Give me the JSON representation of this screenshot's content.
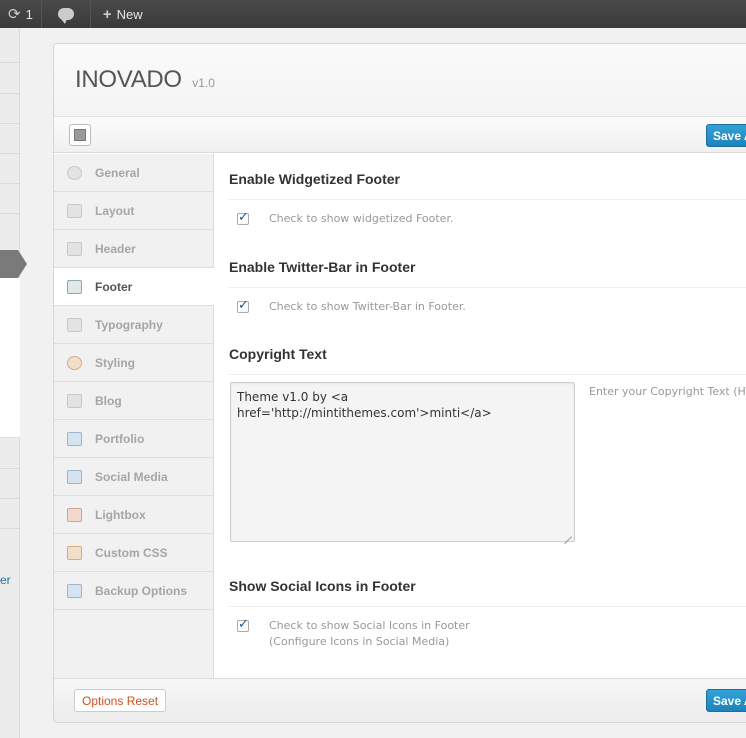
{
  "adminbar": {
    "updates_count": "1",
    "new_label": "New"
  },
  "wp_menu": {
    "partial_link": "er"
  },
  "panel": {
    "theme_name": "INOVADO",
    "theme_version": "v1.0",
    "save_label": "Save Al",
    "reset_label": "Options Reset"
  },
  "nav": [
    {
      "label": "General",
      "icon": "gear-icon"
    },
    {
      "label": "Layout",
      "icon": "layout-icon"
    },
    {
      "label": "Header",
      "icon": "header-icon"
    },
    {
      "label": "Footer",
      "icon": "footer-icon",
      "active": true
    },
    {
      "label": "Typography",
      "icon": "typography-icon"
    },
    {
      "label": "Styling",
      "icon": "palette-icon"
    },
    {
      "label": "Blog",
      "icon": "pencil-icon"
    },
    {
      "label": "Portfolio",
      "icon": "portfolio-icon"
    },
    {
      "label": "Social Media",
      "icon": "twitter-icon"
    },
    {
      "label": "Lightbox",
      "icon": "lightbox-icon"
    },
    {
      "label": "Custom CSS",
      "icon": "css-icon"
    },
    {
      "label": "Backup Options",
      "icon": "backup-icon"
    }
  ],
  "sections": {
    "widget_footer": {
      "title": "Enable Widgetized Footer",
      "desc": "Check to show widgetized Footer.",
      "checked": true
    },
    "twitter_bar": {
      "title": "Enable Twitter-Bar in Footer",
      "desc": "Check to show Twitter-Bar in Footer.",
      "checked": true
    },
    "copyright": {
      "title": "Copyright Text",
      "value": "Theme v1.0 by <a href='http://mintithemes.com'>minti</a>",
      "hint": "Enter your Copyright Text (HT"
    },
    "social_icons": {
      "title": "Show Social Icons in Footer",
      "desc_line1": "Check to show Social Icons in Footer",
      "desc_line2": "(Configure Icons in Social Media)",
      "checked": true
    }
  }
}
